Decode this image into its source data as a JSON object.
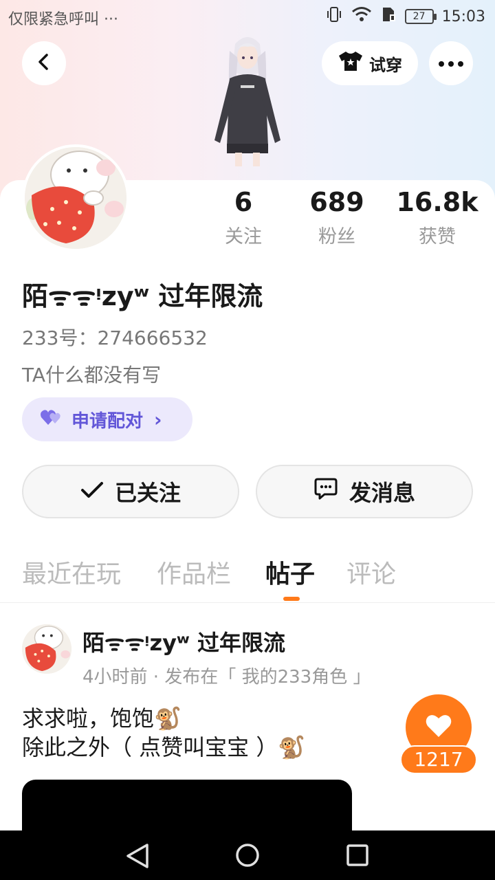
{
  "status_bar": {
    "left_text": "仅限紧急呼叫 ···",
    "battery": "27",
    "time": "15:03"
  },
  "header": {
    "try_on_label": "试穿"
  },
  "stats": [
    {
      "value": "6",
      "label": "关注"
    },
    {
      "value": "689",
      "label": "粉丝"
    },
    {
      "value": "16.8k",
      "label": "获赞"
    }
  ],
  "profile": {
    "username": "陌ᯤᯤᵎzyʷ 过年限流",
    "uid_label": "233号：274666532",
    "bio": "TA什么都没有写"
  },
  "pair_button": {
    "label": "申请配对",
    "chevron": "›"
  },
  "actions": {
    "follow_label": "已关注",
    "message_label": "发消息"
  },
  "tabs": [
    {
      "label": "最近在玩"
    },
    {
      "label": "作品栏"
    },
    {
      "label": "帖子"
    },
    {
      "label": "评论"
    }
  ],
  "post": {
    "author": "陌ᯤᯤᵎzyʷ 过年限流",
    "meta": "4小时前 · 发布在「 我的233角色 」",
    "line1": "求求啦，饱饱🐒",
    "line2": "除此之外（  点赞叫宝宝 ）🐒",
    "like_count": "1217"
  },
  "colors": {
    "accent": "#ff7a1a",
    "pair_purple": "#6256d8"
  }
}
